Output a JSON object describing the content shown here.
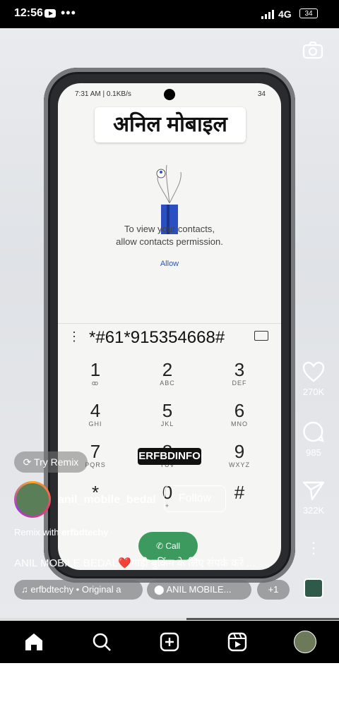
{
  "status_bar": {
    "time": "12:56",
    "more": "•••",
    "network": "4G",
    "battery": "34"
  },
  "reel": {
    "phone_screen": {
      "status_left": "7:31 AM | 0.1KB/s",
      "status_right": "34",
      "title_tag": "अनिल मोबाइल",
      "contacts_message_line1": "To view your contacts,",
      "contacts_message_line2": "allow contacts permission.",
      "allow_label": "Allow",
      "dialed_number": "*#61*915354668#",
      "menu_glyph": "⋮",
      "keys": [
        {
          "digit": "1",
          "letters": "ꝏ"
        },
        {
          "digit": "2",
          "letters": "ABC"
        },
        {
          "digit": "3",
          "letters": "DEF"
        },
        {
          "digit": "4",
          "letters": "GHI"
        },
        {
          "digit": "5",
          "letters": "JKL"
        },
        {
          "digit": "6",
          "letters": "MNO"
        },
        {
          "digit": "7",
          "letters": "PQRS"
        },
        {
          "digit": "8",
          "letters": "TUV"
        },
        {
          "digit": "9",
          "letters": "WXYZ"
        },
        {
          "digit": "*",
          "letters": ""
        },
        {
          "digit": "0",
          "letters": "+"
        },
        {
          "digit": "#",
          "letters": ""
        }
      ],
      "call_label": "Call"
    },
    "watermark": "ERFBDINFO",
    "try_remix_label": "Try Remix",
    "username": "anil_mobile_bedal",
    "follow_label": "Follow",
    "remix_with_prefix": "Remix with",
    "remix_with_user": "erfbdtechy",
    "caption_prefix": "ANIL MOBILE BEDAL",
    "caption_heart": "❤️",
    "caption_suffix": "गाड़ी बुकिंग के लिए संपर्क करें ...",
    "audio_chip": "♫ erfbdtechy • Original a",
    "location_chip": "ANIL MOBILE...",
    "more_chip": "+1",
    "likes": "270K",
    "comments": "985",
    "shares": "322K",
    "more_glyph": "⋮"
  },
  "icons": {
    "camera": "camera-icon",
    "heart": "heart-icon",
    "comment": "comment-icon",
    "share": "send-icon",
    "home": "home-icon",
    "search": "search-icon",
    "add": "add-icon",
    "reels": "reels-icon"
  },
  "playback_progress": 0.55
}
